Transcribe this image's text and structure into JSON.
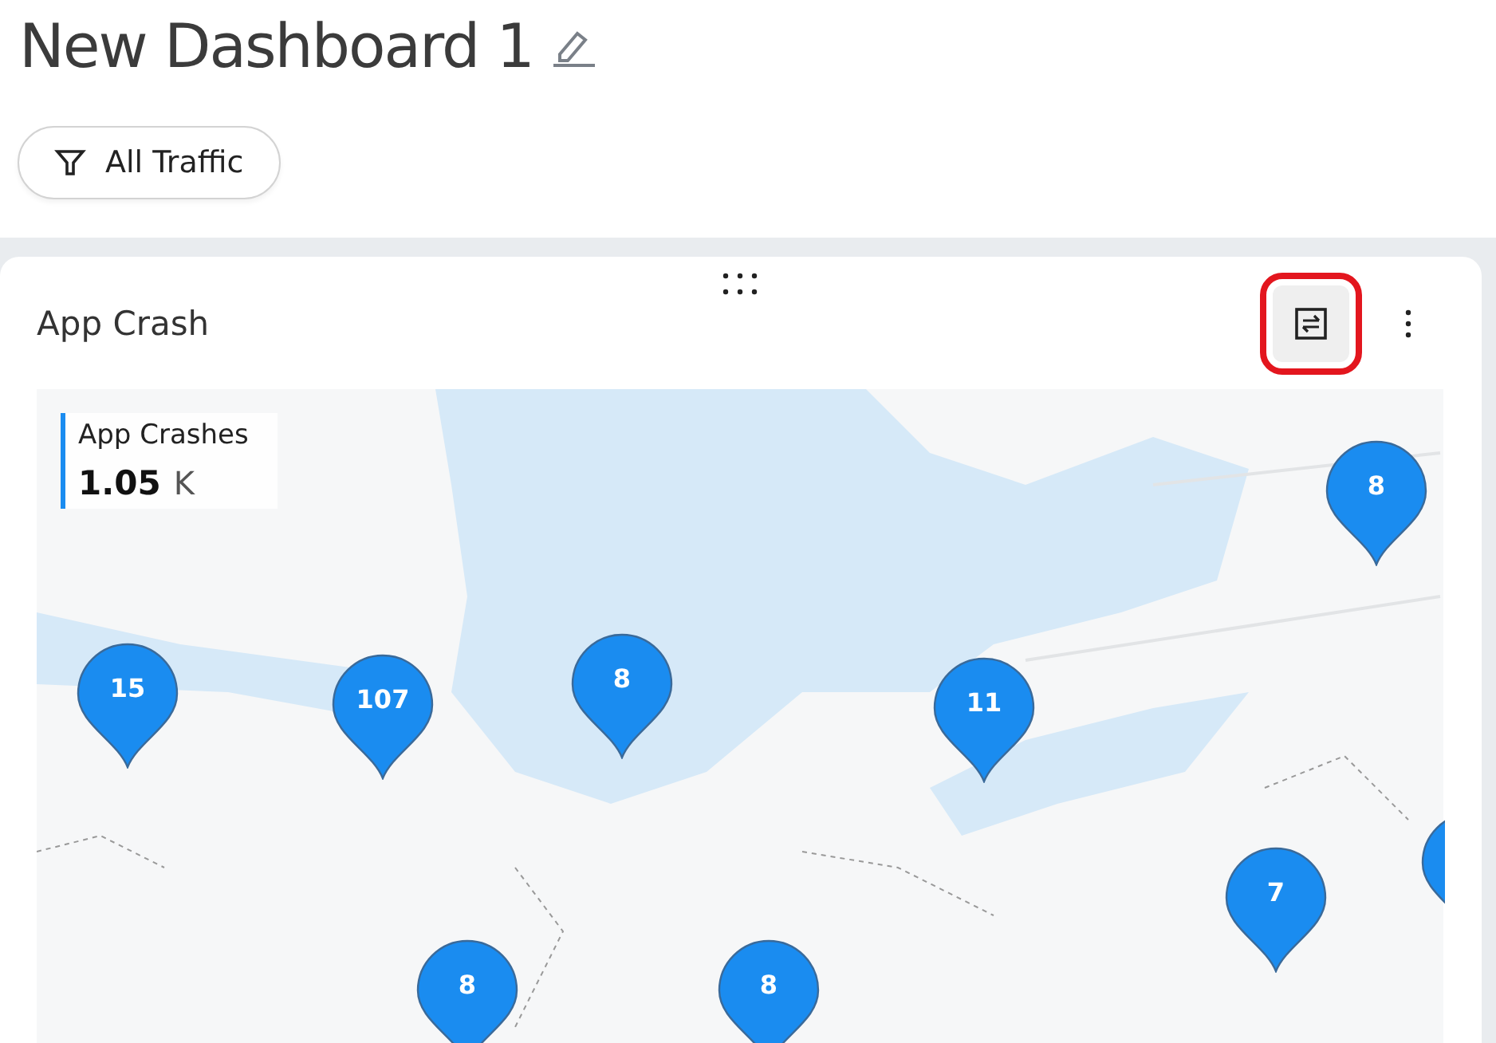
{
  "page": {
    "title": "New Dashboard 1"
  },
  "filter": {
    "label": "All Traffic"
  },
  "widget": {
    "title": "App Crash",
    "swap_button": {
      "highlighted": true
    },
    "legend": {
      "label": "App Crashes",
      "value": "1.05",
      "unit": "K"
    },
    "markers": [
      {
        "count": "15"
      },
      {
        "count": "107"
      },
      {
        "count": "8"
      },
      {
        "count": "11"
      },
      {
        "count": "8"
      },
      {
        "count": "7"
      },
      {
        "count": "8"
      },
      {
        "count": "8"
      }
    ]
  }
}
